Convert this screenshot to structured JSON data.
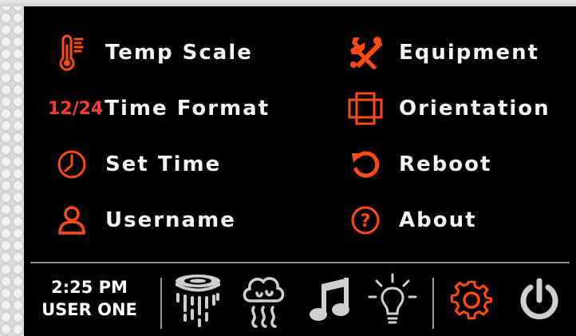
{
  "colors": {
    "accent": "#ff4a12",
    "badge_red": "#ff3b2f",
    "text": "#f2f2f2",
    "inactive_icon": "#cfcfcf",
    "background": "#000000"
  },
  "menu": {
    "items": [
      {
        "label": "Temp Scale",
        "icon": "thermometer-icon"
      },
      {
        "label": "Time Format",
        "icon": "12-24-badge",
        "badge": "12/24"
      },
      {
        "label": "Set Time",
        "icon": "clock-icon"
      },
      {
        "label": "Username",
        "icon": "user-icon"
      },
      {
        "label": "Equipment",
        "icon": "tools-icon"
      },
      {
        "label": "Orientation",
        "icon": "orientation-icon"
      },
      {
        "label": "Reboot",
        "icon": "reboot-icon"
      },
      {
        "label": "About",
        "icon": "help-icon"
      }
    ]
  },
  "status": {
    "time": "2:25 PM",
    "user": "USER ONE"
  },
  "bottom_nav": {
    "tabs": [
      {
        "icon": "shower-icon",
        "active": false
      },
      {
        "icon": "steam-icon",
        "active": false
      },
      {
        "icon": "music-icon",
        "active": false
      },
      {
        "icon": "light-icon",
        "active": false
      },
      {
        "icon": "settings-gear-icon",
        "active": true
      },
      {
        "icon": "power-icon",
        "active": false
      }
    ]
  }
}
